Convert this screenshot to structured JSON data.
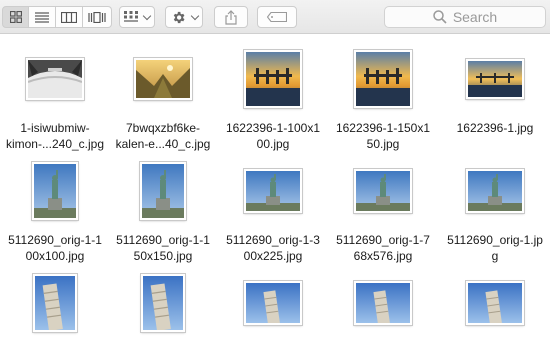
{
  "toolbar": {
    "view_buttons": [
      "icon-view-icon",
      "list-view-icon",
      "column-view-icon",
      "cover-flow-view-icon"
    ],
    "arrange_icon": "arrange-grid-icon",
    "action_icon": "gear-icon",
    "share_icon": "share-icon",
    "tag_icon": "tag-icon",
    "search_placeholder": "Search"
  },
  "files": [
    {
      "line1": "1-isiwubmiw-",
      "line2": "kimon-...240_c.jpg",
      "image": "winter-landscape"
    },
    {
      "line1": "7bwqxzbf6ke-",
      "line2": "kalen-e...40_c.jpg",
      "image": "mountain-valley"
    },
    {
      "line1": "1622396-1-100x1",
      "line2": "00.jpg",
      "image": "pier-sunset"
    },
    {
      "line1": "1622396-1-150x1",
      "line2": "50.jpg",
      "image": "pier-sunset"
    },
    {
      "line1": "1622396-1.jpg",
      "line2": "",
      "image": "pier-sunset"
    },
    {
      "line1": "5112690_orig-1-1",
      "line2": "00x100.jpg",
      "image": "statue-liberty"
    },
    {
      "line1": "5112690_orig-1-1",
      "line2": "50x150.jpg",
      "image": "statue-liberty"
    },
    {
      "line1": "5112690_orig-1-3",
      "line2": "00x225.jpg",
      "image": "statue-liberty"
    },
    {
      "line1": "5112690_orig-1-7",
      "line2": "68x576.jpg",
      "image": "statue-liberty"
    },
    {
      "line1": "5112690_orig-1.jp",
      "line2": "g",
      "image": "statue-liberty"
    },
    {
      "line1": "",
      "line2": "",
      "image": "leaning-tower"
    },
    {
      "line1": "",
      "line2": "",
      "image": "leaning-tower"
    },
    {
      "line1": "",
      "line2": "",
      "image": "leaning-tower"
    },
    {
      "line1": "",
      "line2": "",
      "image": "leaning-tower"
    },
    {
      "line1": "",
      "line2": "",
      "image": "leaning-tower"
    }
  ],
  "colors": {
    "toolbar_bg": "#ebebeb",
    "sky_blue": "#5f8fc9",
    "sunset_orange": "#e8a33c"
  }
}
